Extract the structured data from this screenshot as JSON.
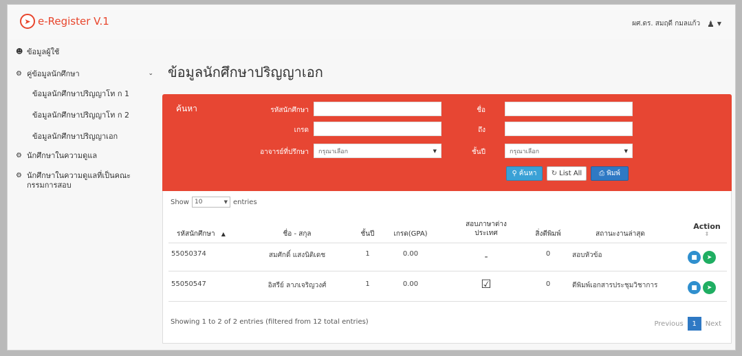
{
  "header": {
    "brand": "e-Register V.1",
    "user_name": "ผศ.ดร. สมฤดี กมลแก้ว"
  },
  "sidebar": {
    "profile": "ข้อมูลผู้ใช้",
    "student_info": "คู่ข้อมูลนักศึกษา",
    "sub_items": [
      "ข้อมูลนักศึกษาปริญญาโท ก 1",
      "ข้อมูลนักศึกษาปริญญาโท ก 2",
      "ข้อมูลนักศึกษาปริญญาเอก"
    ],
    "supervised": "นักศึกษาในความดูแล",
    "committee": "นักศึกษาในความดูแลที่เป็นคณะกรรมการสอบ"
  },
  "page_title": "ข้อมูลนักศึกษาปริญญาเอก",
  "search": {
    "heading": "ค้นหา",
    "student_id_label": "รหัสนักศึกษา",
    "grade_label": "เกรด",
    "advisor_label": "อาจารย์ที่ปรึกษา",
    "name_label": "ชื่อ",
    "to_label": "ถึง",
    "year_label": "ชั้นปี",
    "advisor_value": "กรุณาเลือก",
    "year_value": "กรุณาเลือก",
    "search_button": "ค้นหา",
    "list_all_button": "List All",
    "print_button": "พิมพ์"
  },
  "table": {
    "show_label": "Show",
    "length_value": "10",
    "entries_label": "entries",
    "columns": [
      "รหัสนักศึกษา",
      "ชื่อ - สกุล",
      "ชั้นปี",
      "เกรด(GPA)",
      "สอบภาษาต่าง ประเทศ",
      "สิ่งตีพิมพ์",
      "สถานะงานล่าสุด",
      "Action"
    ],
    "rows": [
      {
        "id": "55050374",
        "name": "สมศักดิ์ แสงนิติเดช",
        "year": "1",
        "gpa": "0.00",
        "lang": "-",
        "pubs": "0",
        "status": "สอบหัวข้อ"
      },
      {
        "id": "55050547",
        "name": "อิสรีย์ ลาภเจริญวงศ์",
        "year": "1",
        "gpa": "0.00",
        "lang": "☑",
        "pubs": "0",
        "status": "ตีพิมพ์เอกสารประชุมวิชาการ"
      }
    ],
    "info": "Showing 1 to 2 of 2 entries (filtered from 12 total entries)",
    "prev": "Previous",
    "page": "1",
    "next": "Next"
  },
  "colors": {
    "brand": "#e8452c",
    "panel": "#e74633",
    "primary": "#2f79c4",
    "success": "#1fae62"
  }
}
